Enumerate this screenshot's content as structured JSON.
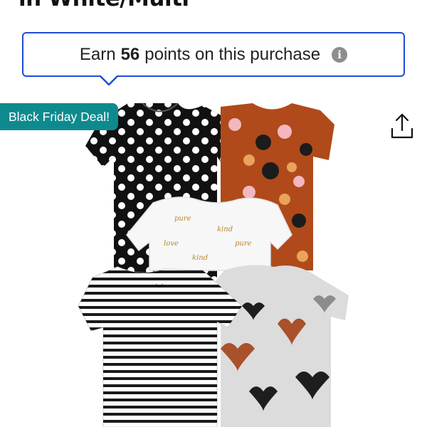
{
  "product": {
    "title_partial": "in White/Multi",
    "image_alt": "5-pack short-sleeve bodysuits: black polka dot, rust floral, white script print, black-and-white stripe, grey hearts"
  },
  "points_banner": {
    "prefix": "Earn",
    "points": "56",
    "suffix": "points on this purchase",
    "info_icon": "info-icon"
  },
  "badge": {
    "label": "Black Friday Deal!"
  },
  "share": {
    "icon": "share-icon"
  },
  "colors": {
    "banner_border": "#1d4ed8",
    "badge_bg": "#0e8a8e",
    "info_icon_bg": "#8d8d8d"
  }
}
